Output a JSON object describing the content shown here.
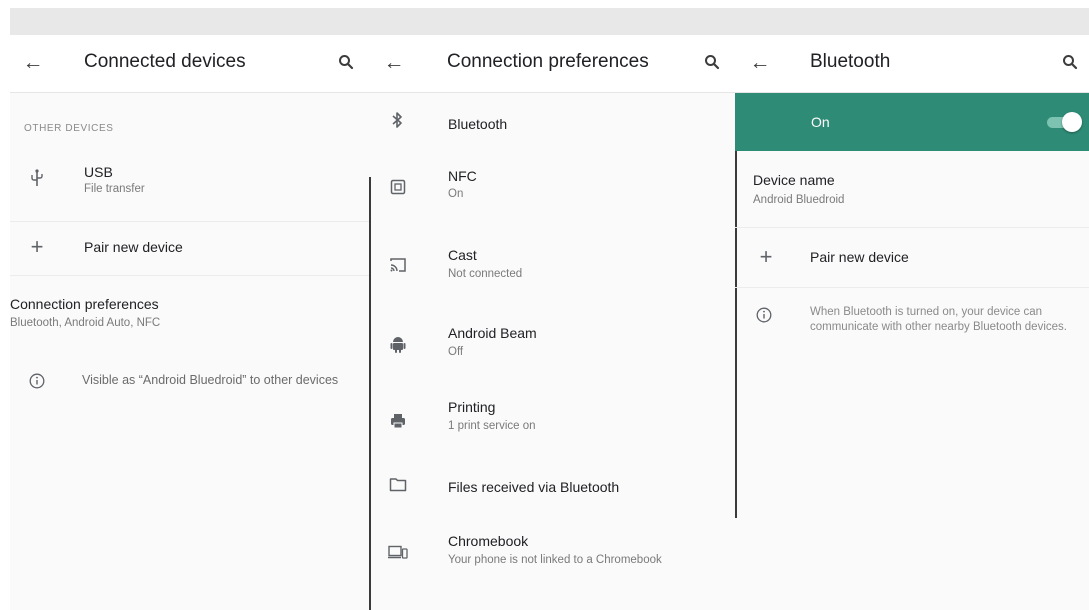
{
  "left_pane": {
    "title": "Connected devices",
    "section_header": "Other devices",
    "usb": {
      "label": "USB",
      "summary": "File transfer"
    },
    "pair_new_device": "Pair new device",
    "connection_preferences": {
      "label": "Connection preferences",
      "summary": "Bluetooth, Android Auto, NFC"
    },
    "visible_as": "Visible as “Android Bluedroid” to other devices"
  },
  "middle_pane": {
    "title": "Connection preferences",
    "items": [
      {
        "label": "Bluetooth",
        "summary": ""
      },
      {
        "label": "NFC",
        "summary": "On"
      },
      {
        "label": "Cast",
        "summary": "Not connected"
      },
      {
        "label": "Android Beam",
        "summary": "Off"
      },
      {
        "label": "Printing",
        "summary": "1 print service on"
      },
      {
        "label": "Files received via Bluetooth",
        "summary": ""
      },
      {
        "label": "Chromebook",
        "summary": "Your phone is not linked to a Chromebook"
      }
    ]
  },
  "right_pane": {
    "title": "Bluetooth",
    "toggle_label": "On",
    "toggle_on": true,
    "device_name": {
      "label": "Device name",
      "value": "Android Bluedroid"
    },
    "pair_new_device": "Pair new device",
    "info": "When Bluetooth is turned on, your device can communicate with other nearby Bluetooth devices."
  },
  "colors": {
    "accent": "#2e8b76",
    "toggle_track": "#7dc3b2",
    "background": "#fafafa"
  },
  "icons": {
    "back": "back-arrow-icon",
    "search": "search-icon",
    "usb": "usb-icon",
    "add": "plus-icon",
    "info": "info-icon",
    "bluetooth": "bluetooth-icon",
    "nfc": "nfc-icon",
    "cast": "cast-icon",
    "android": "android-icon",
    "print": "printer-icon",
    "folder": "folder-icon",
    "chromebook": "chromebook-icon"
  }
}
